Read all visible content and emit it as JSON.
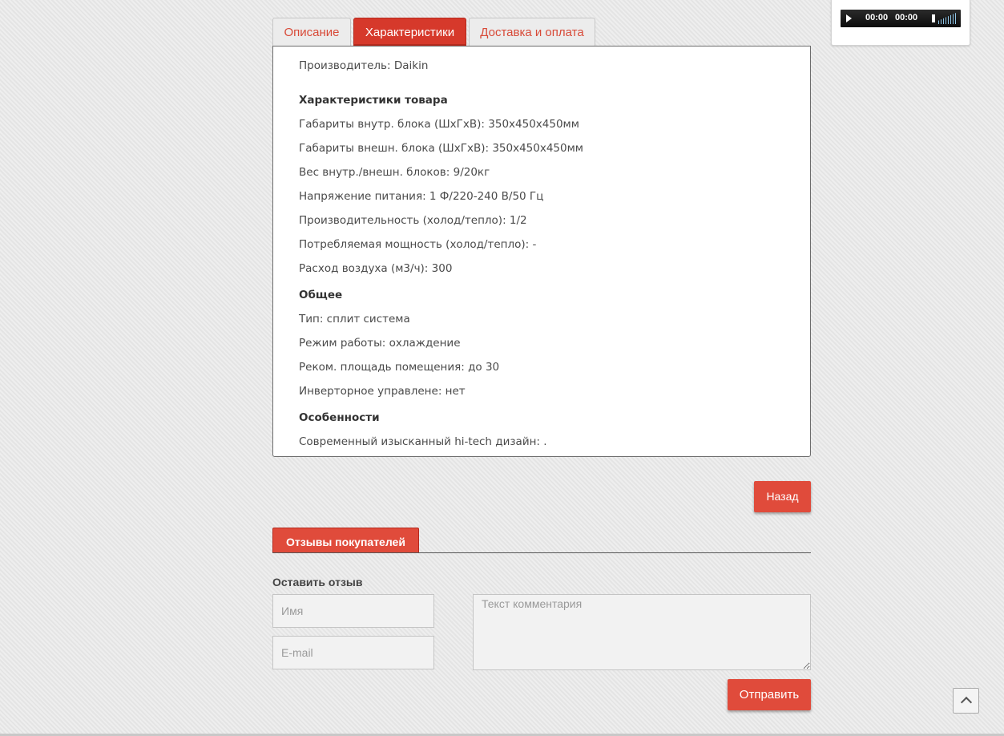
{
  "audio": {
    "time_current": "00:00",
    "time_total": "00:00"
  },
  "tabs": [
    {
      "label": "Описание",
      "active": false
    },
    {
      "label": "Характеристики",
      "active": true
    },
    {
      "label": "Доставка и оплата",
      "active": false
    }
  ],
  "specs": {
    "manufacturer": "Производитель: Daikin",
    "section_product": "Характеристики товара",
    "indoor_dims": "Габариты внутр. блока (ШхГхВ): 350x450x450мм",
    "outdoor_dims": "Габариты внешн. блока (ШхГхВ): 350x450x450мм",
    "weight": "Вес внутр./внешн. блоков: 9/20кг",
    "voltage": "Напряжение питания: 1 Ф/220-240 В/50 Гц",
    "performance": "Производительность (холод/тепло): 1/2",
    "power": "Потребляемая мощность (холод/тепло): -",
    "airflow": "Расход воздуха (м3/ч): 300",
    "section_general": "Общее",
    "type": "Тип: сплит система",
    "mode": "Режим работы: охлаждение",
    "area": "Реком. площадь помещения: до 30",
    "inverter": "Инверторное управлене: нет",
    "section_features": "Особенности",
    "design": "Современный изысканный hi-tech дизайн: ."
  },
  "buttons": {
    "back": "Назад",
    "send": "Отправить"
  },
  "reviews": {
    "tab_label": "Отзывы покупателей",
    "leave_review": "Оставить отзыв",
    "name_placeholder": "Имя",
    "email_placeholder": "E-mail",
    "comment_placeholder": "Текст комментария"
  }
}
